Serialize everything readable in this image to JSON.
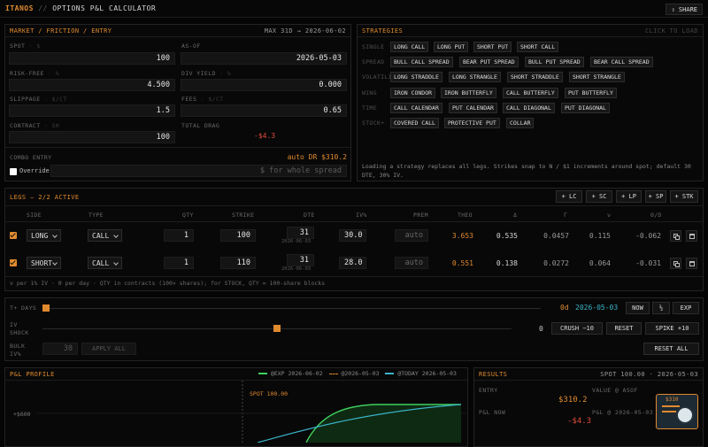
{
  "app": {
    "brand": "ITANOS",
    "sep": "//",
    "title": "OPTIONS P&L CALCULATOR",
    "share": "SHARE"
  },
  "market": {
    "title": "MARKET / FRICTION / ENTRY",
    "max": "MAX 31D → 2026-06-02",
    "spot_label": "SPOT",
    "spot_unit": "$",
    "spot": "100",
    "asof_label": "AS-OF",
    "asof": "2026-05-03",
    "rf_label": "RISK-FREE",
    "rf_unit": "%",
    "rf": "4.500",
    "div_label": "DIV YIELD",
    "div_unit": "%",
    "div": "0.000",
    "slip_label": "SLIPPAGE",
    "slip_unit": "$/CT",
    "slip": "1.5",
    "fees_label": "FEES",
    "fees_unit": "$/CT",
    "fees": "0.65",
    "contract_label": "CONTRACT",
    "contract_unit": "SH",
    "contract": "100",
    "drag_label": "TOTAL DRAG",
    "drag": "-$4.3",
    "combo_label": "COMBO ENTRY",
    "combo": "auto DR $310.2",
    "override_label": "Override",
    "override_placeholder": "$ for whole spread"
  },
  "strategies": {
    "title": "STRATEGIES",
    "hint": "CLICK TO LOAD",
    "groups": [
      {
        "name": "SINGLE",
        "items": [
          "LONG CALL",
          "LONG PUT",
          "SHORT PUT",
          "SHORT CALL"
        ]
      },
      {
        "name": "SPREAD",
        "items": [
          "BULL CALL SPREAD",
          "BEAR PUT SPREAD",
          "BULL PUT SPREAD",
          "BEAR CALL SPREAD"
        ]
      },
      {
        "name": "VOLATILITY",
        "items": [
          "LONG STRADDLE",
          "LONG STRANGLE",
          "SHORT STRADDLE",
          "SHORT STRANGLE"
        ]
      },
      {
        "name": "WING",
        "items": [
          "IRON CONDOR",
          "IRON BUTTERFLY",
          "CALL BUTTERFLY",
          "PUT BUTTERFLY"
        ]
      },
      {
        "name": "TIME",
        "items": [
          "CALL CALENDAR",
          "PUT CALENDAR",
          "CALL DIAGONAL",
          "PUT DIAGONAL"
        ]
      },
      {
        "name": "STOCK+",
        "items": [
          "COVERED CALL",
          "PROTECTIVE PUT",
          "COLLAR"
        ]
      }
    ],
    "note": "Loading a strategy replaces all legs. Strikes snap to N / $1 increments around spot; default 30 DTE, 30% IV."
  },
  "legs": {
    "title": "LEGS — 2/2 ACTIVE",
    "add_buttons": [
      "+ LC",
      "+ SC",
      "+ LP",
      "+ SP",
      "+ STK"
    ],
    "columns": [
      "SIDE",
      "TYPE",
      "QTY",
      "STRIKE",
      "DTE",
      "IV%",
      "PREM",
      "THEO",
      "Δ",
      "Γ",
      "ν",
      "Θ/D"
    ],
    "rows": [
      {
        "side": "LONG",
        "type": "CALL",
        "qty": "1",
        "strike": "100",
        "dte": "31",
        "dte_date": "2026-06-03",
        "iv": "30.0",
        "prem": "auto",
        "theo": "3.653",
        "delta": "0.535",
        "gamma": "0.0457",
        "vega": "0.115",
        "theta": "-0.062"
      },
      {
        "side": "SHORT",
        "type": "CALL",
        "qty": "1",
        "strike": "110",
        "dte": "31",
        "dte_date": "2026-06-03",
        "iv": "28.0",
        "prem": "auto",
        "theo": "0.551",
        "delta": "0.138",
        "gamma": "0.0272",
        "vega": "0.064",
        "theta": "-0.031"
      }
    ],
    "footnote": "ν per 1% IV · Θ per day · QTY in contracts (100× shares); for STOCK, QTY = 100-share blocks"
  },
  "controls": {
    "days_label": "T+ DAYS",
    "days_value": "0d",
    "days_date": "2026-05-03",
    "now": "NOW",
    "half": "½",
    "exp": "EXP",
    "iv_label": "IV SHOCK",
    "iv_value": "0",
    "crush": "CRUSH −10",
    "reset": "RESET",
    "spike": "SPIKE +10",
    "bulk_label": "BULK IV%",
    "bulk_placeholder": "30",
    "apply": "APPLY ALL",
    "reset_all": "RESET ALL",
    "days_pos": 0,
    "iv_pos": 0.5
  },
  "pnl": {
    "title": "P&L PROFILE",
    "legend": [
      "@EXP 2026-06-02",
      "@2026-05-03",
      "@TODAY 2026-05-03"
    ],
    "spot_label": "SPOT 100.00",
    "ytick": "+$600"
  },
  "results": {
    "title": "RESULTS",
    "spot": "SPOT 100.00 · 2026-05-03",
    "entry_label": "ENTRY",
    "entry": "$310.2",
    "value_label": "VALUE @ ASOF",
    "pnl_now_label": "P&L NOW",
    "pnl_now": "-$4.3",
    "pnl_at_label": "P&L @ 2026-05-03",
    "badge": "$310"
  },
  "colors": {
    "accent": "#e08a2e",
    "neg": "#e04b3a",
    "exp_line": "#3fcf5f",
    "mid_line": "#e08a2e",
    "today_line": "#3ab4c8"
  }
}
